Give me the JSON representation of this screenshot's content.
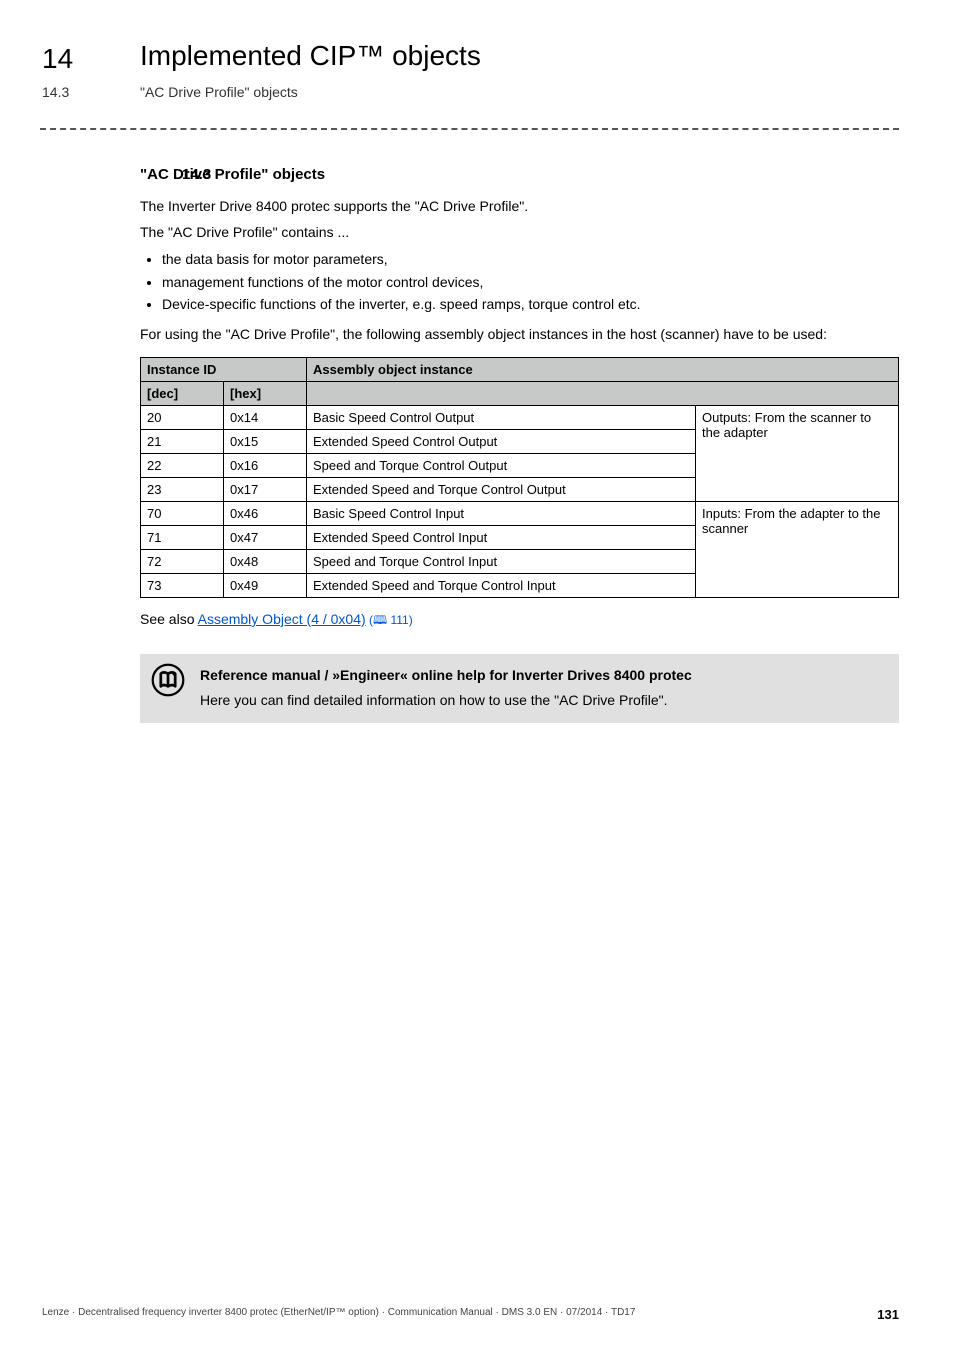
{
  "chapter": {
    "num": "14",
    "title": "Implemented CIP™ objects"
  },
  "subheader": {
    "num": "14.3",
    "title": "\"AC Drive Profile\" objects"
  },
  "section": {
    "num": "14.3",
    "title": "\"AC Drive Profile\" objects",
    "para1": "The Inverter Drive 8400 protec supports the \"AC Drive Profile\".",
    "para2": "The \"AC Drive Profile\" contains ...",
    "bullets": [
      "the data basis for motor parameters,",
      "management functions of the motor control devices,",
      "Device-specific functions of the inverter, e.g. speed ramps, torque control etc."
    ],
    "para3": "For using the \"AC Drive Profile\", the following assembly object instances in the host (scanner) have to be used:"
  },
  "table": {
    "head": {
      "instance": "Instance ID",
      "dec": "[dec]",
      "hex": "[hex]",
      "assembly": "Assembly object instance"
    },
    "group_out": "Outputs: From the scanner to the adapter",
    "group_in": "Inputs: From the adapter to the scanner",
    "rows": [
      {
        "dec": "20",
        "hex": "0x14",
        "desc": "Basic Speed Control Output"
      },
      {
        "dec": "21",
        "hex": "0x15",
        "desc": "Extended Speed Control Output"
      },
      {
        "dec": "22",
        "hex": "0x16",
        "desc": "Speed and Torque Control Output"
      },
      {
        "dec": "23",
        "hex": "0x17",
        "desc": "Extended Speed and Torque Control Output"
      },
      {
        "dec": "70",
        "hex": "0x46",
        "desc": "Basic Speed Control Input"
      },
      {
        "dec": "71",
        "hex": "0x47",
        "desc": "Extended Speed Control Input"
      },
      {
        "dec": "72",
        "hex": "0x48",
        "desc": "Speed and Torque Control Input"
      },
      {
        "dec": "73",
        "hex": "0x49",
        "desc": "Extended Speed and Torque Control Input"
      }
    ]
  },
  "seealso": {
    "prefix": "See also ",
    "link": "Assembly Object (4 / 0x04)",
    "suffix": " (🕮 111)"
  },
  "infobox": {
    "title": "Reference manual / »Engineer« online help for Inverter Drives 8400 protec",
    "text": "Here you can find detailed information on how to use the \"AC Drive Profile\"."
  },
  "footer": {
    "left": "Lenze · Decentralised frequency inverter 8400 protec (EtherNet/IP™ option) · Communication Manual · DMS 3.0 EN · 07/2014 · TD17",
    "page": "131"
  }
}
